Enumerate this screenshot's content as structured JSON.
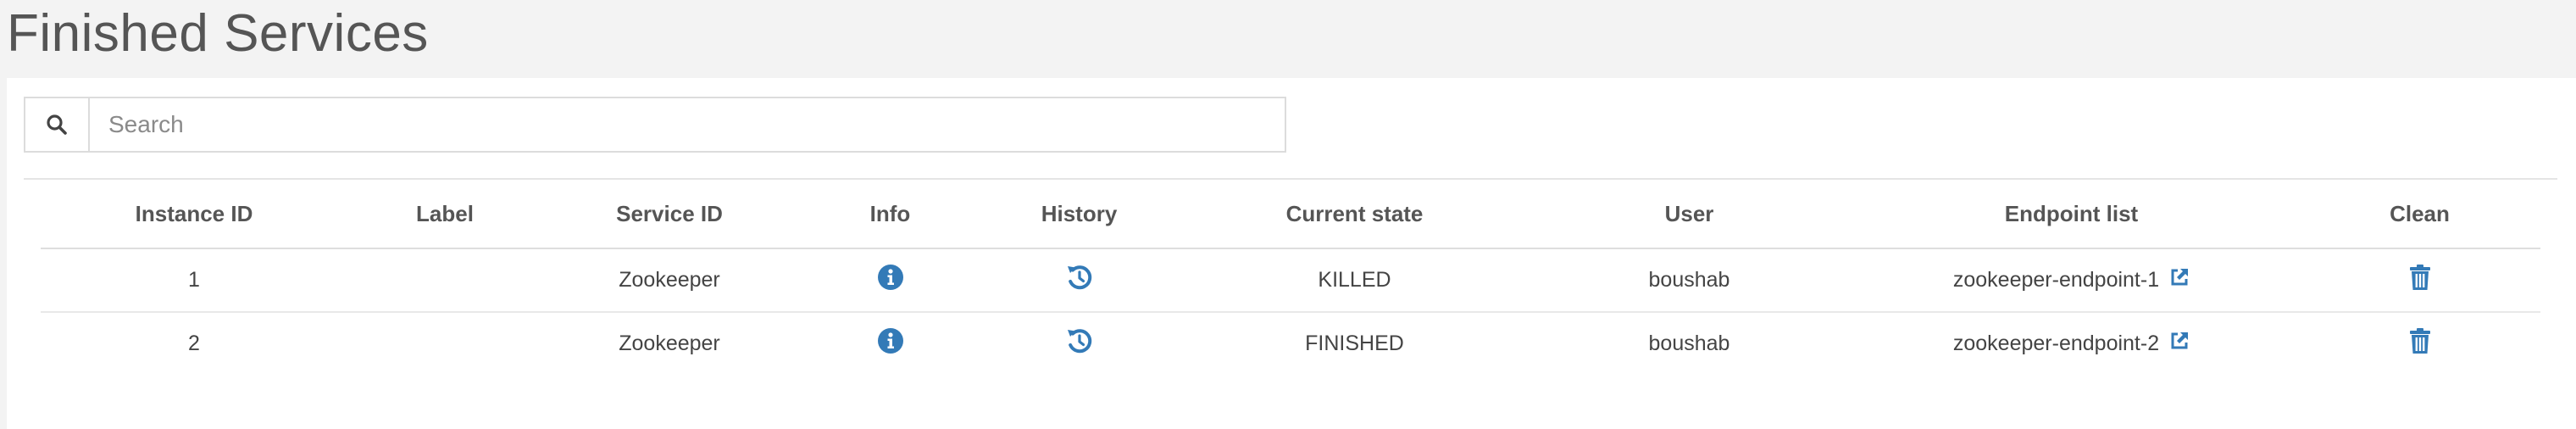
{
  "page": {
    "title": "Finished Services"
  },
  "search": {
    "placeholder": "Search",
    "value": "",
    "icon": "search-icon"
  },
  "colors": {
    "accent": "#337ab7",
    "background": "#f3f3f3",
    "panel": "#ffffff"
  },
  "table": {
    "headers": {
      "instance_id": "Instance ID",
      "label": "Label",
      "service_id": "Service ID",
      "info": "Info",
      "history": "History",
      "current_state": "Current state",
      "user": "User",
      "endpoint_list": "Endpoint list",
      "clean": "Clean"
    },
    "rows": [
      {
        "instance_id": "1",
        "label": "",
        "service_id": "Zookeeper",
        "current_state": "KILLED",
        "user": "boushab",
        "endpoint": "zookeeper-endpoint-1"
      },
      {
        "instance_id": "2",
        "label": "",
        "service_id": "Zookeeper",
        "current_state": "FINISHED",
        "user": "boushab",
        "endpoint": "zookeeper-endpoint-2"
      }
    ],
    "icons": {
      "info": "info-icon",
      "history": "history-icon",
      "external_link": "external-link-icon",
      "clean": "trash-icon"
    }
  }
}
